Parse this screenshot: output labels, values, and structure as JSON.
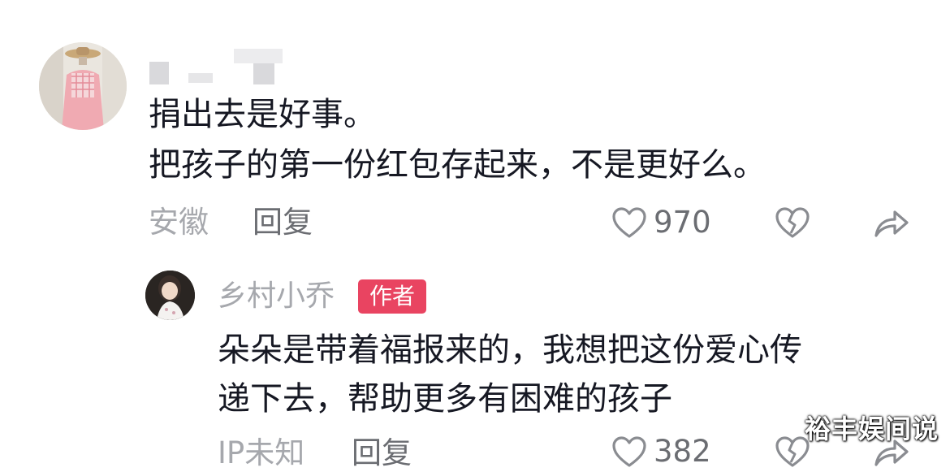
{
  "comment": {
    "username": "",
    "text_line1": "捐出去是好事。",
    "text_line2": "把孩子的第一份红包存起来，不是更好么。",
    "location": "安徽",
    "reply_label": "回复",
    "like_count": "970"
  },
  "reply": {
    "username": "乡村小乔",
    "badge": "作者",
    "text_line1": "朵朵是带着福报来的，我想把这份爱心传",
    "text_line2": "递下去，帮助更多有困难的孩子",
    "location": "IP未知",
    "reply_label": "回复",
    "like_count": "382"
  },
  "watermark": "裕丰娱间说",
  "colors": {
    "badge": "#e94461",
    "meta": "#a6a8ad",
    "action": "#6b6d72",
    "text": "#161823"
  },
  "icons": [
    "heart-icon",
    "dislike-icon",
    "share-icon"
  ]
}
